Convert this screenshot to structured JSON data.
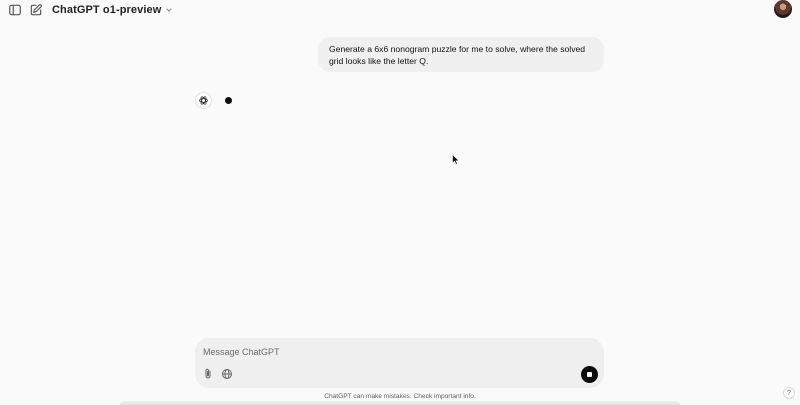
{
  "header": {
    "model_name": "ChatGPT o1-preview",
    "icons": {
      "sidebar_toggle": "sidebar-toggle-icon",
      "new_chat": "new-chat-icon",
      "model_chevron": "chevron-down-icon"
    }
  },
  "conversation": {
    "user_message": "Generate a 6x6 nonogram puzzle for me to solve, where the solved grid looks like the letter Q.",
    "assistant_state": "thinking"
  },
  "composer": {
    "placeholder": "Message ChatGPT",
    "value": ""
  },
  "footer": {
    "disclaimer": "ChatGPT can make mistakes. Check important info.",
    "help_label": "?"
  },
  "colors": {
    "background": "#fafafa",
    "bubble": "#f0f0f0",
    "composer": "#efefef",
    "accent": "#0d0d0d"
  }
}
